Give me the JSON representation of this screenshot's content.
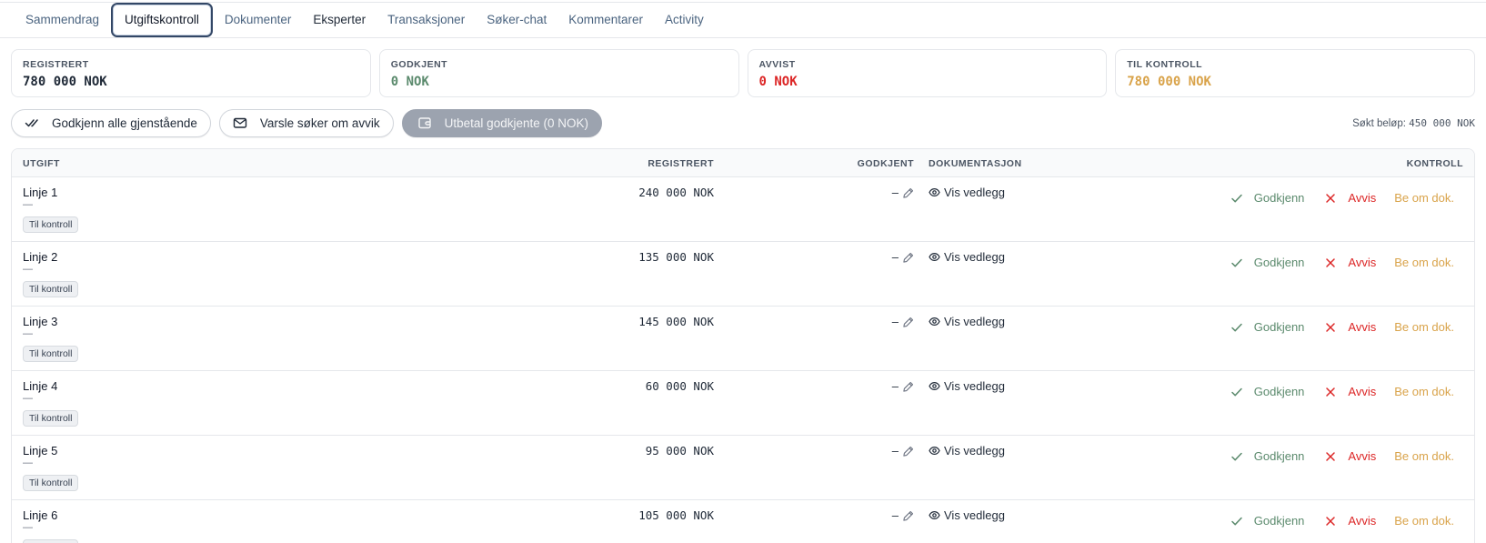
{
  "tabs": [
    {
      "label": "Sammendrag"
    },
    {
      "label": "Utgiftskontroll"
    },
    {
      "label": "Dokumenter"
    },
    {
      "label": "Eksperter"
    },
    {
      "label": "Transaksjoner"
    },
    {
      "label": "Søker-chat"
    },
    {
      "label": "Kommentarer"
    },
    {
      "label": "Activity"
    }
  ],
  "summary": {
    "registrert": {
      "label": "REGISTRERT",
      "value": "780 000 NOK",
      "color": "#1f2937"
    },
    "godkjent": {
      "label": "GODKJENT",
      "value": "0 NOK",
      "color": "#5b8a6d"
    },
    "avvist": {
      "label": "AVVIST",
      "value": "0 NOK",
      "color": "#dc2626"
    },
    "til_kontroll": {
      "label": "TIL KONTROLL",
      "value": "780 000 NOK",
      "color": "#d9a34a"
    }
  },
  "actions": {
    "approve_all": "Godkjenn alle gjenstående",
    "notify": "Varsle søker om avvik",
    "payout": "Utbetal godkjente (0 NOK)",
    "sokt_label": "Søkt beløp:",
    "sokt_value": "450 000 NOK"
  },
  "table": {
    "headers": {
      "utgift": "UTGIFT",
      "registrert": "REGISTRERT",
      "godkjent": "GODKJENT",
      "dokumentasjon": "DOKUMENTASJON",
      "kontroll": "KONTROLL"
    },
    "rows": [
      {
        "name": "Linje 1",
        "sub": "—",
        "status": "Til kontroll",
        "registrert": "240 000 NOK",
        "godkjent": "–",
        "doc": "Vis vedlegg",
        "approve": "Godkjenn",
        "reject": "Avvis",
        "request": "Be om dok."
      },
      {
        "name": "Linje 2",
        "sub": "—",
        "status": "Til kontroll",
        "registrert": "135 000 NOK",
        "godkjent": "–",
        "doc": "Vis vedlegg",
        "approve": "Godkjenn",
        "reject": "Avvis",
        "request": "Be om dok."
      },
      {
        "name": "Linje 3",
        "sub": "—",
        "status": "Til kontroll",
        "registrert": "145 000 NOK",
        "godkjent": "–",
        "doc": "Vis vedlegg",
        "approve": "Godkjenn",
        "reject": "Avvis",
        "request": "Be om dok."
      },
      {
        "name": "Linje 4",
        "sub": "—",
        "status": "Til kontroll",
        "registrert": "60 000 NOK",
        "godkjent": "–",
        "doc": "Vis vedlegg",
        "approve": "Godkjenn",
        "reject": "Avvis",
        "request": "Be om dok."
      },
      {
        "name": "Linje 5",
        "sub": "—",
        "status": "Til kontroll",
        "registrert": "95 000 NOK",
        "godkjent": "–",
        "doc": "Vis vedlegg",
        "approve": "Godkjenn",
        "reject": "Avvis",
        "request": "Be om dok."
      },
      {
        "name": "Linje 6",
        "sub": "—",
        "status": "Til kontroll",
        "registrert": "105 000 NOK",
        "godkjent": "–",
        "doc": "Vis vedlegg",
        "approve": "Godkjenn",
        "reject": "Avvis",
        "request": "Be om dok."
      }
    ]
  },
  "icons": {
    "double_check": "double-check-icon",
    "mail": "mail-icon",
    "wallet": "wallet-icon",
    "pencil": "pencil-icon",
    "eye": "eye-icon",
    "check": "check-icon",
    "x": "x-icon"
  }
}
